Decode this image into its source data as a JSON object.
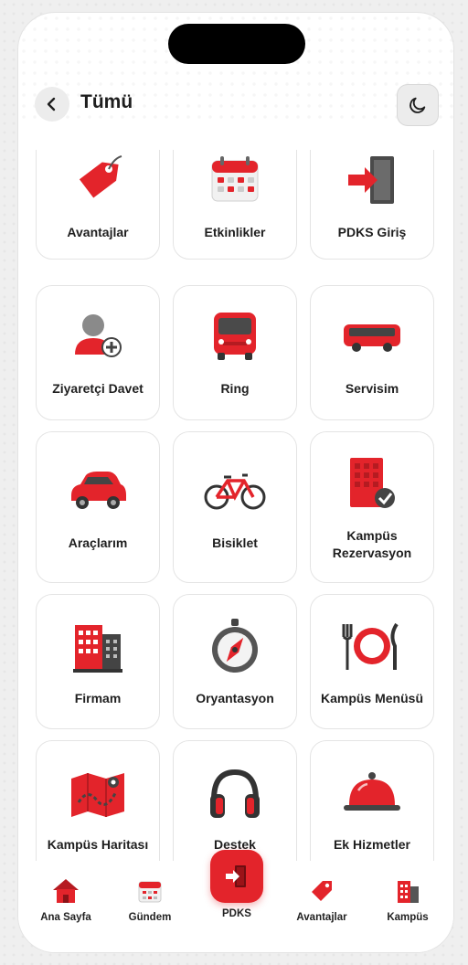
{
  "header": {
    "title": "Tümü"
  },
  "tiles": [
    {
      "label": "Avantajlar",
      "icon": "tag-icon"
    },
    {
      "label": "Etkinlikler",
      "icon": "calendar-icon"
    },
    {
      "label": "PDKS Giriş",
      "icon": "door-enter-icon"
    },
    {
      "label": "Ziyaretçi Davet",
      "icon": "add-person-icon"
    },
    {
      "label": "Ring",
      "icon": "minibus-icon"
    },
    {
      "label": "Servisim",
      "icon": "bus-icon"
    },
    {
      "label": "Araçlarım",
      "icon": "car-icon"
    },
    {
      "label": "Bisiklet",
      "icon": "bicycle-icon"
    },
    {
      "label": "Kampüs Rezervasyon",
      "icon": "building-check-icon"
    },
    {
      "label": "Firmam",
      "icon": "office-buildings-icon"
    },
    {
      "label": "Oryantasyon",
      "icon": "compass-icon"
    },
    {
      "label": "Kampüs Menüsü",
      "icon": "plate-cutlery-icon"
    },
    {
      "label": "Kampüs Haritası",
      "icon": "map-icon"
    },
    {
      "label": "Destek",
      "icon": "headphones-icon"
    },
    {
      "label": "Ek Hizmetler",
      "icon": "service-cloche-icon"
    }
  ],
  "bottom_nav": {
    "home": "Ana Sayfa",
    "agenda": "Gündem",
    "pdks": "PDKS",
    "advantages": "Avantajlar",
    "campus": "Kampüs"
  },
  "colors": {
    "accent": "#e3242b",
    "card_border": "#e4e4e4",
    "text": "#1f1f1f"
  }
}
